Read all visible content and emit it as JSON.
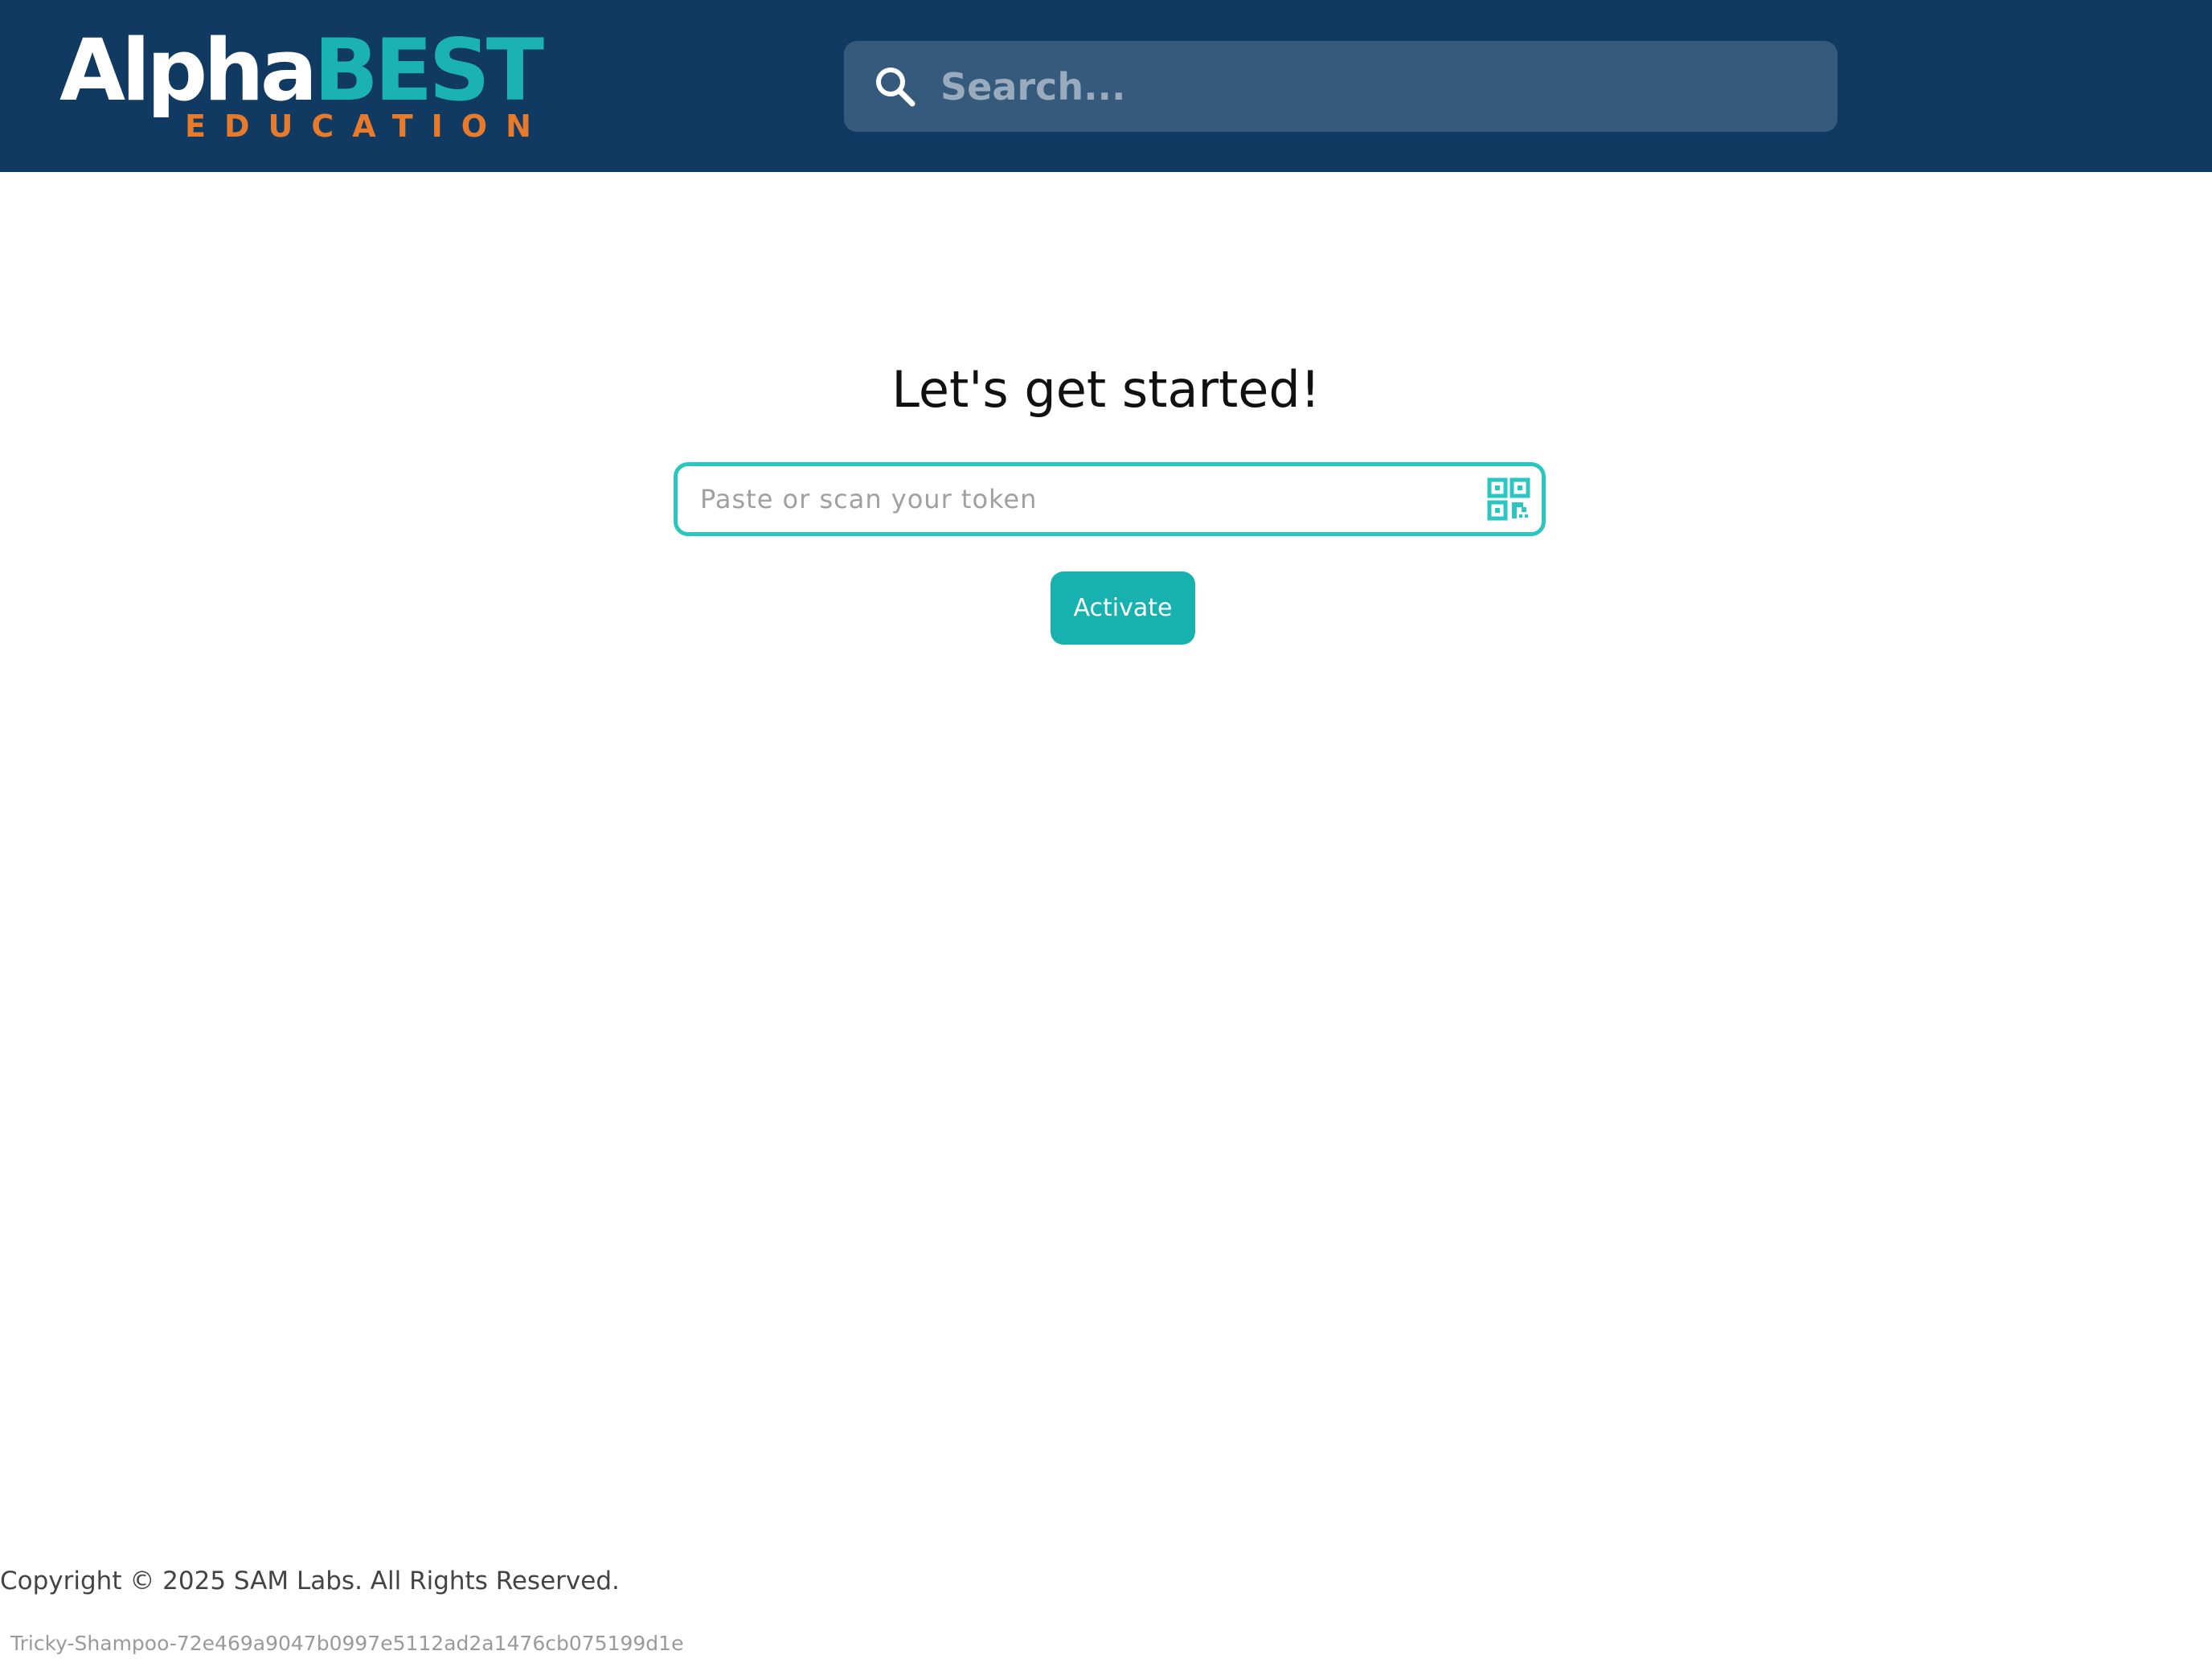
{
  "header": {
    "logo": {
      "word_white": "Alpha",
      "word_teal": "BEST",
      "subtitle": "EDUCATION"
    },
    "search": {
      "placeholder": "Search...",
      "value": "",
      "icon": "search-icon"
    }
  },
  "main": {
    "title": "Let's get started!",
    "token_field": {
      "placeholder": "Paste or scan your token",
      "value": "",
      "icon": "qr-code-icon"
    },
    "activate_label": "Activate"
  },
  "footer": {
    "copyright": "Copyright © 2025 SAM Labs. All Rights Reserved.",
    "build_id": "Tricky-Shampoo-72e469a9047b0997e5112ad2a1476cb075199d1e"
  },
  "colors": {
    "header_bg": "#113a62",
    "search_bg": "#355a7c",
    "accent_teal": "#17b1b0",
    "field_border": "#2ac7c0",
    "logo_orange": "#e87b2b"
  }
}
